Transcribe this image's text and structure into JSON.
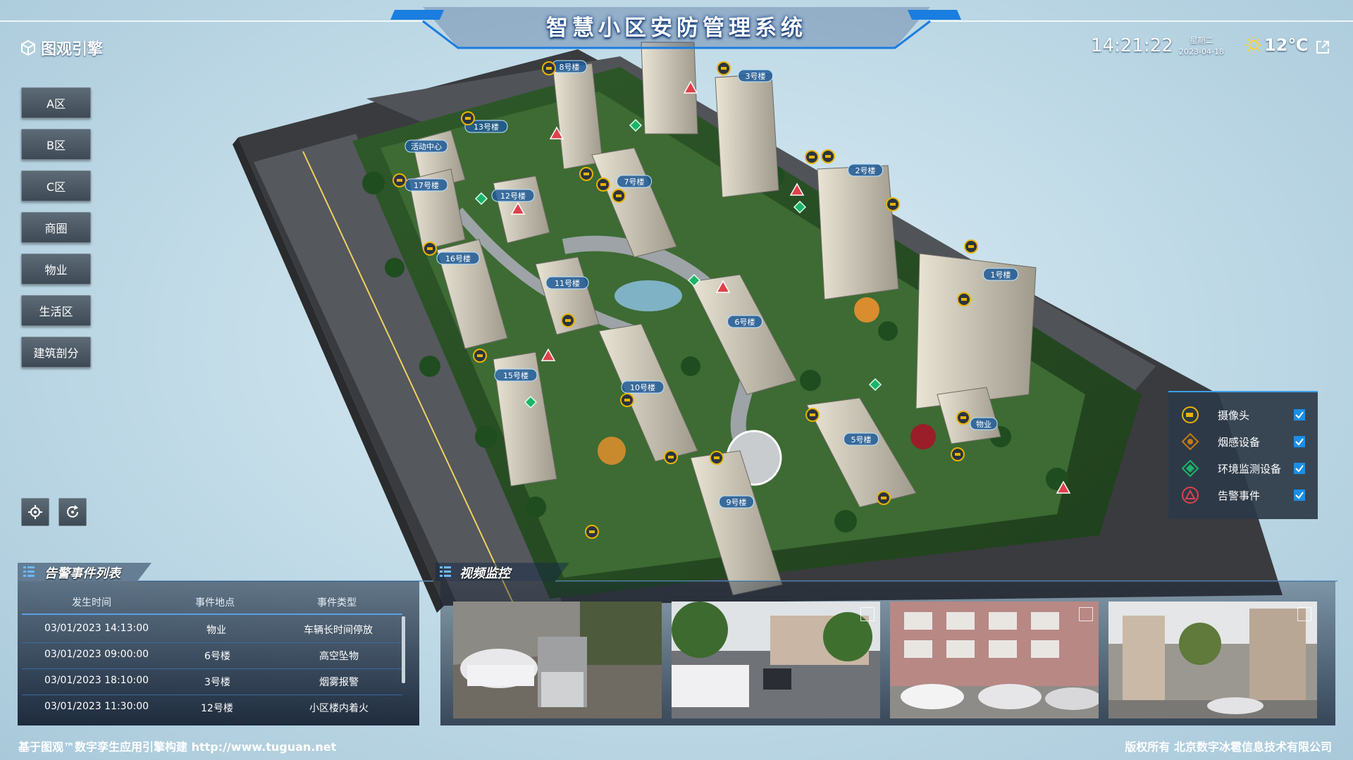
{
  "header": {
    "title": "智慧小区安防管理系统",
    "logo_text": "图观引擎",
    "time": "14:21:22",
    "weekday": "星期二",
    "date": "2023-04-18",
    "temperature": "12℃",
    "weather_icon": "sun-icon",
    "exit_icon": "external-link-icon"
  },
  "nav": {
    "items": [
      "A区",
      "B区",
      "C区",
      "商圈",
      "物业",
      "生活区",
      "建筑剖分"
    ]
  },
  "tools": {
    "locate_icon": "crosshair-icon",
    "reset_icon": "refresh-icon"
  },
  "buildings": [
    "8号楼",
    "3号楼",
    "13号楼",
    "活动中心",
    "17号楼",
    "7号楼",
    "12号楼",
    "2号楼",
    "16号楼",
    "11号楼",
    "1号楼",
    "6号楼",
    "15号楼",
    "10号楼",
    "物业",
    "5号楼",
    "9号楼"
  ],
  "legend": {
    "items": [
      {
        "label": "摄像头",
        "icon": "camera-icon",
        "color": "#e8b400",
        "checked": true
      },
      {
        "label": "烟感设备",
        "icon": "smoke-detector-icon",
        "color": "#c67a10",
        "checked": true
      },
      {
        "label": "环境监测设备",
        "icon": "environment-sensor-icon",
        "color": "#1bb56a",
        "checked": true
      },
      {
        "label": "告警事件",
        "icon": "alarm-icon",
        "color": "#e0404a",
        "checked": true
      }
    ]
  },
  "alarm_panel": {
    "title": "告警事件列表",
    "columns": [
      "发生时间",
      "事件地点",
      "事件类型"
    ],
    "rows": [
      [
        "03/01/2023 14:13:00",
        "物业",
        "车辆长时间停放"
      ],
      [
        "03/01/2023 09:00:00",
        "6号楼",
        "高空坠物"
      ],
      [
        "03/01/2023 18:10:00",
        "3号楼",
        "烟雾报警"
      ],
      [
        "03/01/2023 11:30:00",
        "12号楼",
        "小区楼内着火"
      ]
    ]
  },
  "video_panel": {
    "title": "视频监控"
  },
  "footer": {
    "left": "基于图观™数字孪生应用引擎构建 http://www.tuguan.net",
    "right": "版权所有 北京数字冰雹信息技术有限公司"
  }
}
